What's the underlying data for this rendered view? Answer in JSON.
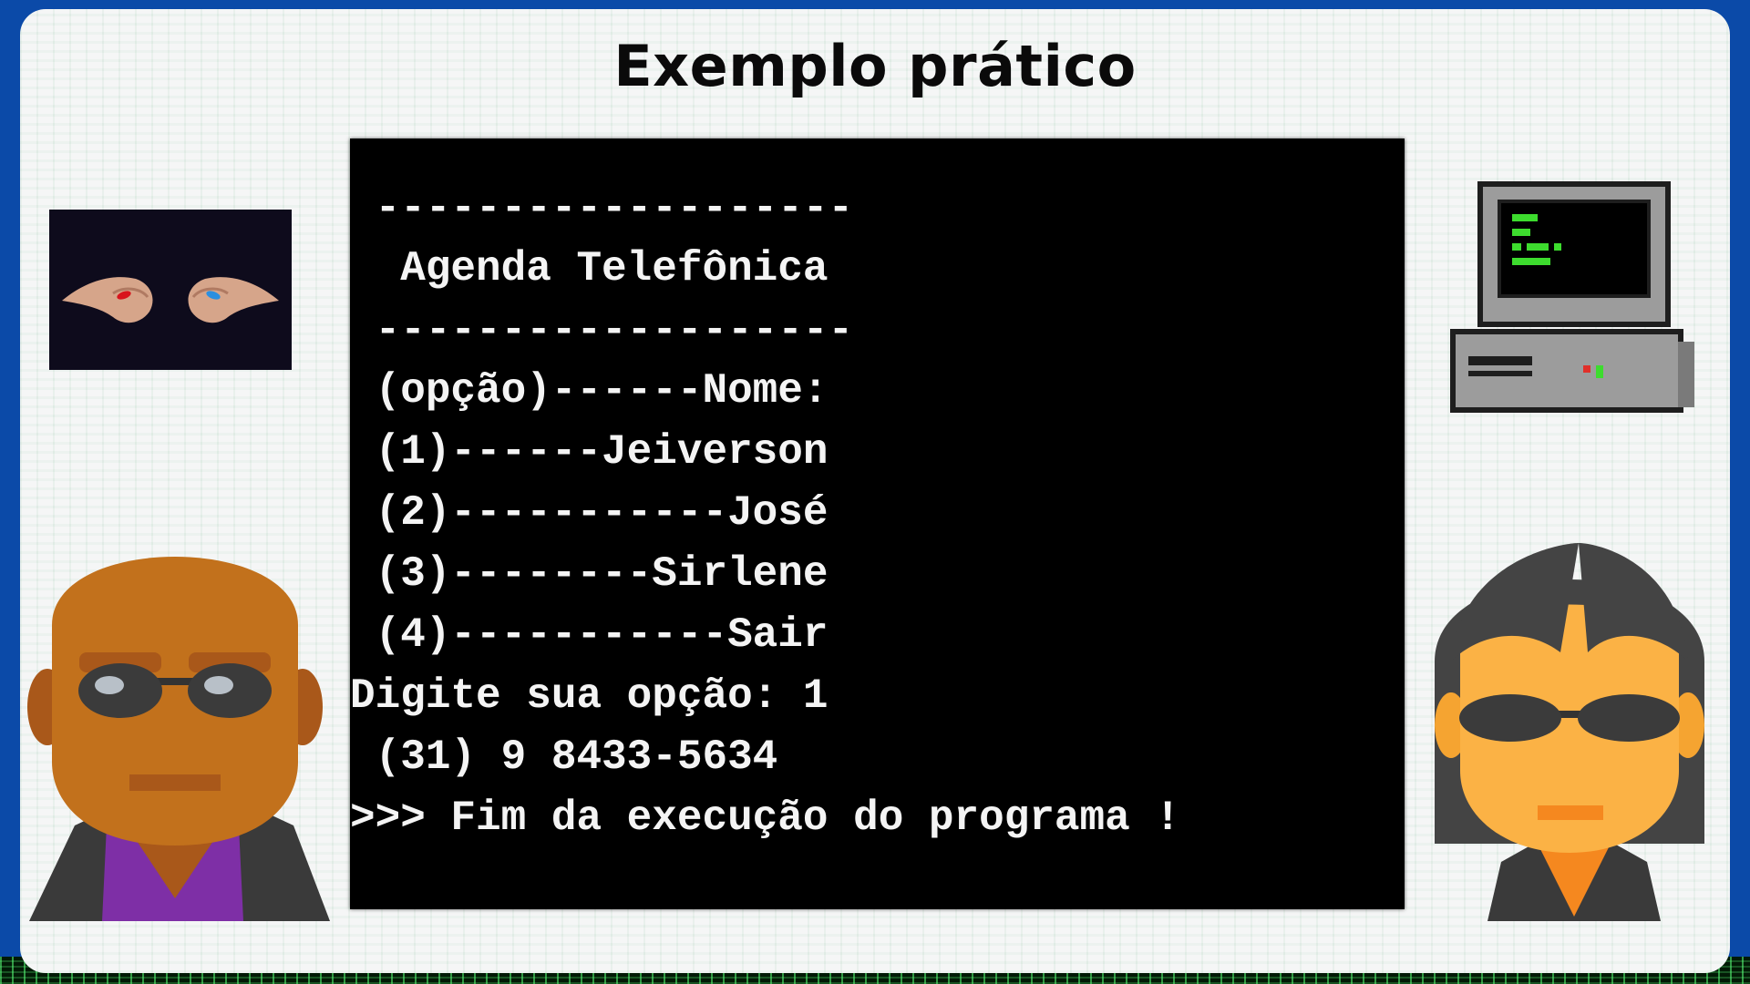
{
  "slide": {
    "title": "Exemplo prático"
  },
  "terminal": {
    "lines": [
      " -------------------",
      "  Agenda Telefônica",
      " -------------------",
      " (opção)------Nome:",
      " (1)------Jeiverson",
      " (2)-----------José",
      " (3)--------Sirlene",
      " (4)-----------Sair",
      "Digite sua opção: 1",
      " (31) 9 8433-5634",
      ">>> Fim da execução do programa !"
    ]
  },
  "icons": {
    "pills": "red-blue-pills-hands-image",
    "computer": "retro-computer-icon",
    "morpheus": "morpheus-avatar-icon",
    "trinity": "trinity-avatar-icon"
  },
  "colors": {
    "frame_blue": "#0b4aa8",
    "card_bg": "#f5f6f6",
    "terminal_bg": "#000000",
    "terminal_text": "#f4f4f4"
  }
}
